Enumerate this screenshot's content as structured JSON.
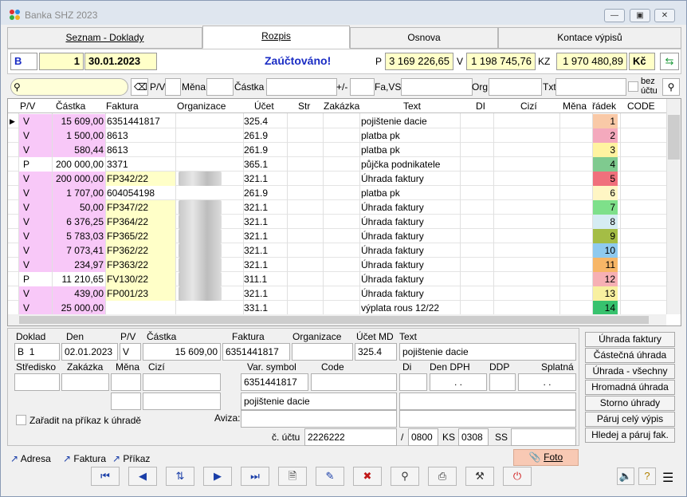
{
  "window": {
    "title": "Banka SHZ  2023"
  },
  "tabs": [
    "Seznam - Doklady",
    "Rozpis",
    "Osnova",
    "Kontace výpisů"
  ],
  "header": {
    "type": "B",
    "number": "1",
    "date": "30.01.2023",
    "status": "Zaúčtováno!",
    "p_label": "P",
    "p_value": "3 169 226,65",
    "v_label": "V",
    "v_value": "1 198 745,76",
    "kz_label": "KZ",
    "kz_value": "1 970 480,89",
    "currency": "Kč"
  },
  "filter": {
    "pv": "P/V",
    "mena": "Měna",
    "castka": "Částka",
    "plusminus": "+/-",
    "favs": "Fa,VS",
    "org": "Org",
    "txt": "Txt",
    "bez_uctu": "bez účtu"
  },
  "columns": [
    "P/V",
    "Částka",
    "Faktura",
    "Organizace",
    "Účet",
    "Str",
    "Zakázka",
    "Text",
    "DI",
    "Cizí",
    "Měna",
    "řádek",
    "CODE"
  ],
  "rows": [
    {
      "pv": "V",
      "castka": "15 609,00",
      "faktura": "6351441817",
      "org": "",
      "ucet": "325.4",
      "text": "pojištenie dacie",
      "radek": "1",
      "color": "#f9c9a7",
      "pvcolor": "#f8c8f8",
      "fakyel": false
    },
    {
      "pv": "V",
      "castka": "1 500,00",
      "faktura": "8613",
      "org": "",
      "ucet": "261.9",
      "text": "platba pk",
      "radek": "2",
      "color": "#f4a9bd",
      "pvcolor": "#f8c8f8",
      "fakyel": false
    },
    {
      "pv": "V",
      "castka": "580,44",
      "faktura": "8613",
      "org": "",
      "ucet": "261.9",
      "text": "platba pk",
      "radek": "3",
      "color": "#fff3a0",
      "pvcolor": "#f8c8f8",
      "fakyel": false
    },
    {
      "pv": "P",
      "castka": "200 000,00",
      "faktura": "3371",
      "org": "",
      "ucet": "365.1",
      "text": "půjčka podnikatele",
      "radek": "4",
      "color": "#7fca8f",
      "pvcolor": "#ffffff",
      "fakyel": false
    },
    {
      "pv": "V",
      "castka": "200 000,00",
      "faktura": "FP342/22",
      "org": "blur",
      "ucet": "321.1",
      "text": "Úhrada faktury",
      "radek": "5",
      "color": "#f0707c",
      "pvcolor": "#f8c8f8",
      "fakyel": true
    },
    {
      "pv": "V",
      "castka": "1 707,00",
      "faktura": "604054198",
      "org": "",
      "ucet": "261.9",
      "text": "platba pk",
      "radek": "6",
      "color": "#fff6c4",
      "pvcolor": "#f8c8f8",
      "fakyel": false
    },
    {
      "pv": "V",
      "castka": "50,00",
      "faktura": "FP347/22",
      "org": "blur",
      "ucet": "321.1",
      "text": "Úhrada faktury",
      "radek": "7",
      "color": "#7ee08a",
      "pvcolor": "#f8c8f8",
      "fakyel": true
    },
    {
      "pv": "V",
      "castka": "6 376,25",
      "faktura": "FP364/22",
      "org": "blur",
      "ucet": "321.1",
      "text": "Úhrada faktury",
      "radek": "8",
      "color": "#d5ecf2",
      "pvcolor": "#f8c8f8",
      "fakyel": true
    },
    {
      "pv": "V",
      "castka": "5 783,03",
      "faktura": "FP365/22",
      "org": "blur",
      "ucet": "321.1",
      "text": "Úhrada faktury",
      "radek": "9",
      "color": "#a4bd45",
      "pvcolor": "#f8c8f8",
      "fakyel": true
    },
    {
      "pv": "V",
      "castka": "7 073,41",
      "faktura": "FP362/22",
      "org": "blur",
      "ucet": "321.1",
      "text": "Úhrada faktury",
      "radek": "10",
      "color": "#8fcaef",
      "pvcolor": "#f8c8f8",
      "fakyel": true
    },
    {
      "pv": "V",
      "castka": "234,97",
      "faktura": "FP363/22",
      "org": "blur",
      "ucet": "321.1",
      "text": "Úhrada faktury",
      "radek": "11",
      "color": "#f7b667",
      "pvcolor": "#f8c8f8",
      "fakyel": true
    },
    {
      "pv": "P",
      "castka": "11 210,65",
      "faktura": "FV130/22",
      "org": "blur",
      "ucet": "311.1",
      "text": "Úhrada faktury",
      "radek": "12",
      "color": "#f6b0b4",
      "pvcolor": "#ffffff",
      "fakyel": true
    },
    {
      "pv": "V",
      "castka": "439,00",
      "faktura": "FP001/23",
      "org": "blur",
      "ucet": "321.1",
      "text": "Úhrada faktury",
      "radek": "13",
      "color": "#f8f0a0",
      "pvcolor": "#f8c8f8",
      "fakyel": true
    },
    {
      "pv": "V",
      "castka": "25 000,00",
      "faktura": "",
      "org": "",
      "ucet": "331.1",
      "text": "výplata rous 12/22",
      "radek": "14",
      "color": "#38c26e",
      "pvcolor": "#f8c8f8",
      "fakyel": false
    }
  ],
  "detail": {
    "labels": {
      "doklad": "Doklad",
      "den": "Den",
      "pv": "P/V",
      "castka": "Částka",
      "faktura": "Faktura",
      "organizace": "Organizace",
      "ucetmd": "Účet MD",
      "text": "Text",
      "stredisko": "Středisko",
      "zakazka": "Zakázka",
      "mena": "Měna",
      "cizi": "Cizí",
      "varsym": "Var. symbol",
      "code": "Code",
      "di": "Di",
      "denddph": "Den DPH",
      "ddp": "DDP",
      "splatna": "Splatná",
      "zaradit": "Zařadit na příkaz k úhradě",
      "aviza": "Aviza:",
      "cucetu": "č. účtu",
      "ks": "KS",
      "ss": "SS",
      "slash": "/"
    },
    "doklad_type": "B",
    "doklad_no": "1",
    "den": "02.01.2023",
    "pv": "V",
    "castka": "15 609,00",
    "faktura": "6351441817",
    "ucetmd": "325.4",
    "text": "pojištenie dacie",
    "varsym": "6351441817",
    "dendph": ". .",
    "splatna": ". .",
    "text2": "pojištenie dacie",
    "cucetu": "2226222",
    "bank": "0800",
    "ks": "0308"
  },
  "right_buttons": [
    "Úhrada faktury",
    "Částečná úhrada",
    "Úhrada - všechny",
    "Hromadná úhrada",
    "Storno úhrady",
    "Páruj celý výpis",
    "Hledej a páruj fak."
  ],
  "links": [
    "Adresa",
    "Faktura",
    "Příkaz"
  ],
  "foto": "Foto"
}
